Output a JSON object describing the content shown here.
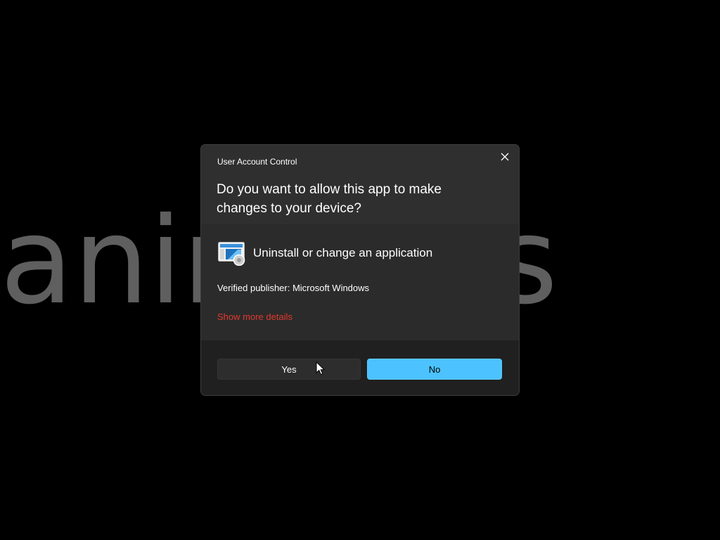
{
  "watermark": {
    "text": "anirtricks",
    "color": "#6a6a6a"
  },
  "dialog": {
    "title": "User Account Control",
    "question": "Do you want to allow this app to make changes to your device?",
    "close_icon": "close-icon",
    "app": {
      "icon": "program-settings-icon",
      "name": "Uninstall or change an application"
    },
    "publisher": "Verified publisher: Microsoft Windows",
    "more_details": "Show more details",
    "buttons": {
      "yes": "Yes",
      "no": "No"
    },
    "colors": {
      "accent": "#4cc2ff",
      "link": "#e0392e",
      "header_bg": "#2f2f2f",
      "footer_bg": "#202020"
    }
  },
  "pointer": {
    "icon": "mouse-pointer-icon"
  }
}
